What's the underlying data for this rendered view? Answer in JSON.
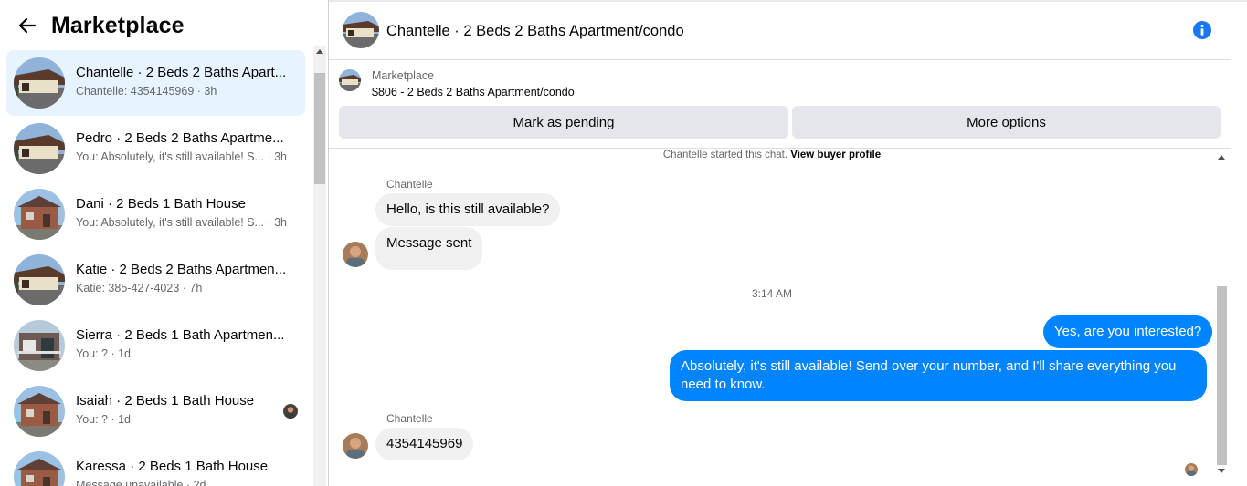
{
  "sidebar": {
    "title": "Marketplace",
    "back_icon": "arrow-left-icon",
    "conversations": [
      {
        "name": "Chantelle · 2 Beds 2 Baths Apart...",
        "snippet": "Chantelle: 4354145969",
        "time": "3h",
        "active": true,
        "thumb": "house-brown"
      },
      {
        "name": "Pedro · 2 Beds 2 Baths Apartme...",
        "snippet": "You: Absolutely, it's still available! S...",
        "time": "3h",
        "active": false,
        "thumb": "house-brown"
      },
      {
        "name": "Dani · 2 Beds 1 Bath House",
        "snippet": "You: Absolutely, it's still available! S...",
        "time": "3h",
        "active": false,
        "thumb": "house-brick"
      },
      {
        "name": "Katie · 2 Beds 2 Baths Apartmen...",
        "snippet": "Katie: 385-427-4023",
        "time": "7h",
        "active": false,
        "thumb": "house-brown"
      },
      {
        "name": "Sierra · 2 Beds 1 Bath Apartmen...",
        "snippet": "You: ?",
        "time": "1d",
        "active": false,
        "thumb": "house-porch"
      },
      {
        "name": "Isaiah · 2 Beds 1 Bath House",
        "snippet": "You: ?",
        "time": "1d",
        "active": false,
        "thumb": "house-brick",
        "seen": true
      },
      {
        "name": "Karessa · 2 Beds 1 Bath House",
        "snippet": "Message unavailable",
        "time": "2d",
        "active": false,
        "thumb": "house-brick"
      }
    ]
  },
  "chat": {
    "header_title": "Chantelle · 2 Beds 2 Baths Apartment/condo",
    "info_icon": "info-icon",
    "listing": {
      "label": "Marketplace",
      "price_line": "$806 - 2 Beds 2 Baths Apartment/condo"
    },
    "buttons": {
      "pending": "Mark as pending",
      "more": "More options"
    },
    "started_text": "Chantelle started this chat.",
    "started_link": "View buyer profile",
    "sender_name_1": "Chantelle",
    "msg_in_1": "Hello, is this still available?",
    "msg_in_2": "Message sent",
    "timestamp": "3:14 AM",
    "msg_out_1": "Yes, are you interested?",
    "msg_out_2": "Absolutely, it's still available! Send over your number, and I'll share everything you need to know.",
    "sender_name_2": "Chantelle",
    "msg_in_3": "4354145969"
  },
  "colors": {
    "accent": "#0084ff",
    "active_bg": "#e7f3ff",
    "bubble_in": "#f0f0f0",
    "button_bg": "#e4e6eb",
    "info_blue": "#1877f2"
  }
}
